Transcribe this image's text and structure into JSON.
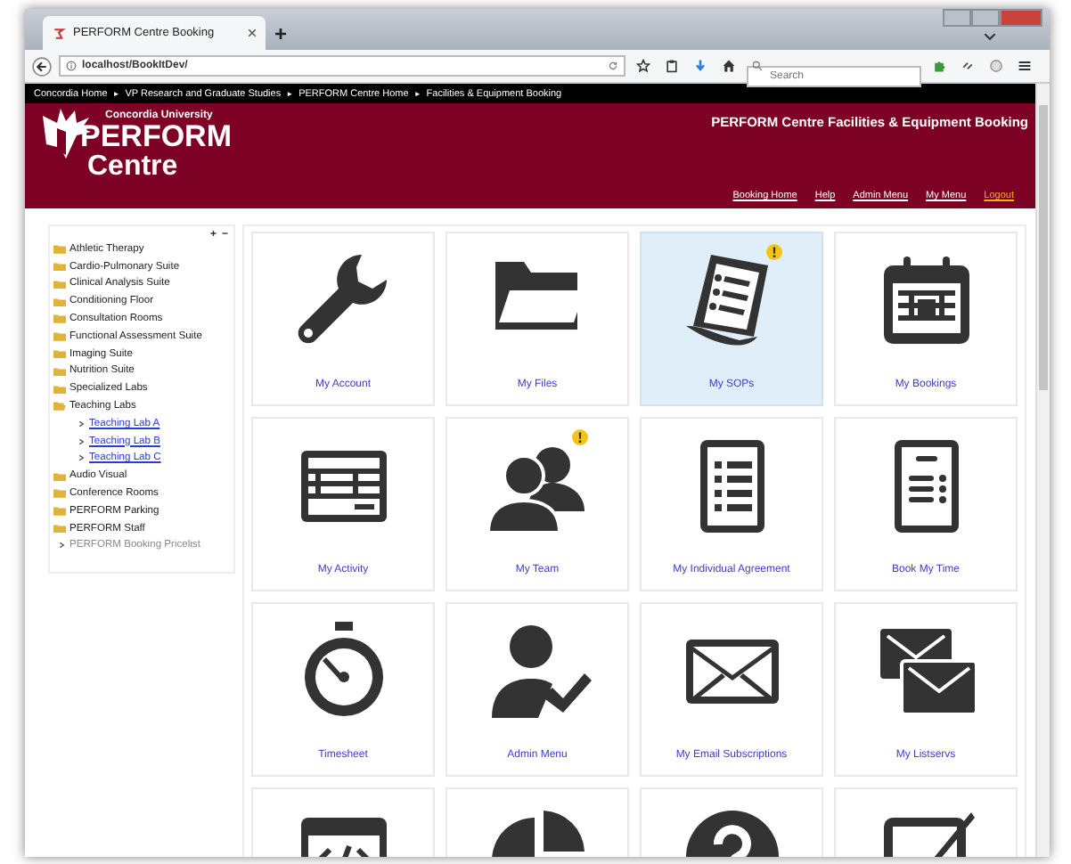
{
  "browser": {
    "tab_title": "PERFORM Centre Booking",
    "new_tab": "+",
    "url": "localhost/BookItDev/",
    "search": {
      "placeholder": "Search"
    }
  },
  "breadcrumb": [
    "Concordia Home",
    "►",
    "VP Research and Graduate Studies",
    "►",
    "PERFORM Centre Home",
    "►",
    "Facilities & Equipment Booking"
  ],
  "header": {
    "logo_top": "Concordia University",
    "logo_main": "PERFORM",
    "logo_sub": "Centre",
    "title": "PERFORM Centre Facilities & Equipment Booking",
    "nav": [
      {
        "label": "Booking Home",
        "color": "#ffffff"
      },
      {
        "label": "Help",
        "color": "#ffffff"
      },
      {
        "label": "Admin Menu",
        "color": "#ffffff"
      },
      {
        "label": "My Menu",
        "color": "#ffffff"
      },
      {
        "label": "Logout",
        "color": "#f5b400"
      }
    ]
  },
  "sidebar": {
    "expand": "+",
    "collapse": "−",
    "items": [
      {
        "label": "Athletic Therapy",
        "kind": "folder",
        "expanded": false
      },
      {
        "label": "Cardio-Pulmonary Suite",
        "kind": "folder",
        "expanded": false
      },
      {
        "label": "Clinical Analysis Suite",
        "kind": "folder",
        "expanded": false
      },
      {
        "label": "Conditioning Floor",
        "kind": "folder",
        "expanded": false
      },
      {
        "label": "Consultation Rooms",
        "kind": "folder",
        "expanded": false
      },
      {
        "label": "Functional Assessment Suite",
        "kind": "folder",
        "expanded": false
      },
      {
        "label": "Imaging Suite",
        "kind": "folder",
        "expanded": false
      },
      {
        "label": "Nutrition Suite",
        "kind": "folder",
        "expanded": false
      },
      {
        "label": "Specialized Labs",
        "kind": "folder",
        "expanded": false
      },
      {
        "label": "Teaching Labs",
        "kind": "folder",
        "expanded": true,
        "children": [
          {
            "label": "Teaching Lab A",
            "kind": "link"
          },
          {
            "label": "Teaching Lab B",
            "kind": "link"
          },
          {
            "label": "Teaching Lab C",
            "kind": "link"
          }
        ]
      },
      {
        "label": "Audio Visual",
        "kind": "folder",
        "expanded": false
      },
      {
        "label": "Conference Rooms",
        "kind": "folder",
        "expanded": false
      },
      {
        "label": "PERFORM Parking",
        "kind": "folder",
        "expanded": false
      },
      {
        "label": "PERFORM Staff",
        "kind": "folder",
        "expanded": false
      },
      {
        "label": "PERFORM Booking Pricelist",
        "kind": "page"
      }
    ]
  },
  "tiles": [
    {
      "label": "My Account",
      "kind": "wrench",
      "selected": false,
      "alert": false
    },
    {
      "label": "My Files",
      "kind": "folder",
      "selected": false,
      "alert": false
    },
    {
      "label": "My SOPs",
      "kind": "scroll",
      "selected": true,
      "alert": true
    },
    {
      "label": "My Bookings",
      "kind": "calendar",
      "selected": false,
      "alert": false
    },
    {
      "label": "My Activity",
      "kind": "form",
      "selected": false,
      "alert": false
    },
    {
      "label": "My Team",
      "kind": "people",
      "selected": false,
      "alert": true
    },
    {
      "label": "My Individual Agreement",
      "kind": "list",
      "selected": false,
      "alert": false
    },
    {
      "label": "Book My Time",
      "kind": "document",
      "selected": false,
      "alert": false
    },
    {
      "label": "Timesheet",
      "kind": "stopwatch",
      "selected": false,
      "alert": false
    },
    {
      "label": "Admin Menu",
      "kind": "person-check",
      "selected": false,
      "alert": false
    },
    {
      "label": "My Email Subscriptions",
      "kind": "envelope",
      "selected": false,
      "alert": false
    },
    {
      "label": "My Listservs",
      "kind": "envelopes",
      "selected": false,
      "alert": false
    },
    {
      "kind": "code",
      "selected": false,
      "alert": false
    },
    {
      "kind": "pie",
      "selected": false,
      "alert": false
    },
    {
      "kind": "question",
      "selected": false,
      "alert": false
    },
    {
      "kind": "check",
      "selected": false,
      "alert": false
    }
  ]
}
